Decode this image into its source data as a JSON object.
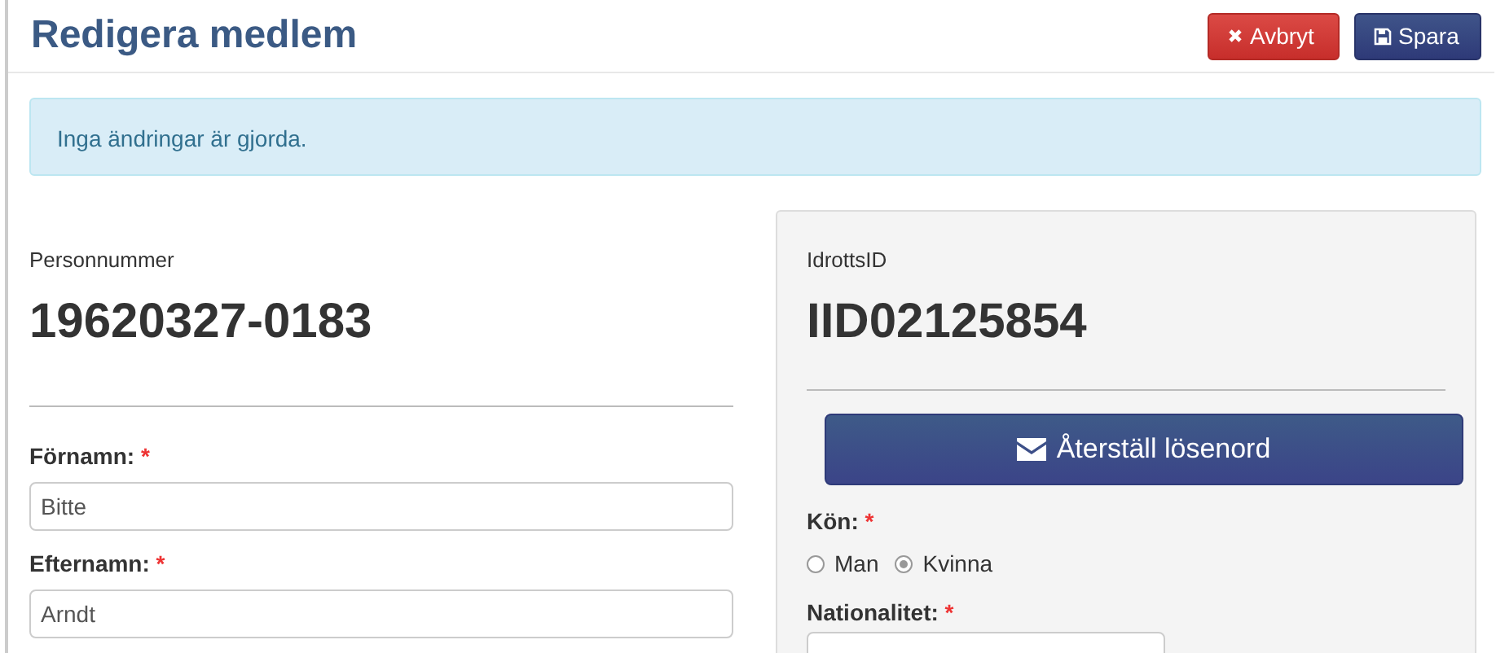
{
  "header": {
    "title": "Redigera medlem",
    "buttons": [
      {
        "kind": "cancel",
        "label": "Avbryt"
      },
      {
        "kind": "save",
        "label": "Spara"
      }
    ]
  },
  "alert": "Inga ändringar är gjorda.",
  "left": {
    "id_label": "Personnummer",
    "id_value": "19620327-0183",
    "fields": [
      {
        "label": "Förnamn:",
        "required": "*",
        "value": "Bitte"
      },
      {
        "label": "Efternamn:",
        "required": "*",
        "value": "Arndt"
      }
    ]
  },
  "right": {
    "id_label": "IdrottsID",
    "id_value": "IID02125854",
    "reset_button": "Återställ lösenord",
    "gender": {
      "label": "Kön:",
      "required": "*",
      "options": [
        {
          "label": "Man",
          "selected": false
        },
        {
          "label": "Kvinna",
          "selected": true
        }
      ]
    },
    "nationality": {
      "label": "Nationalitet:",
      "required": "*"
    }
  }
}
